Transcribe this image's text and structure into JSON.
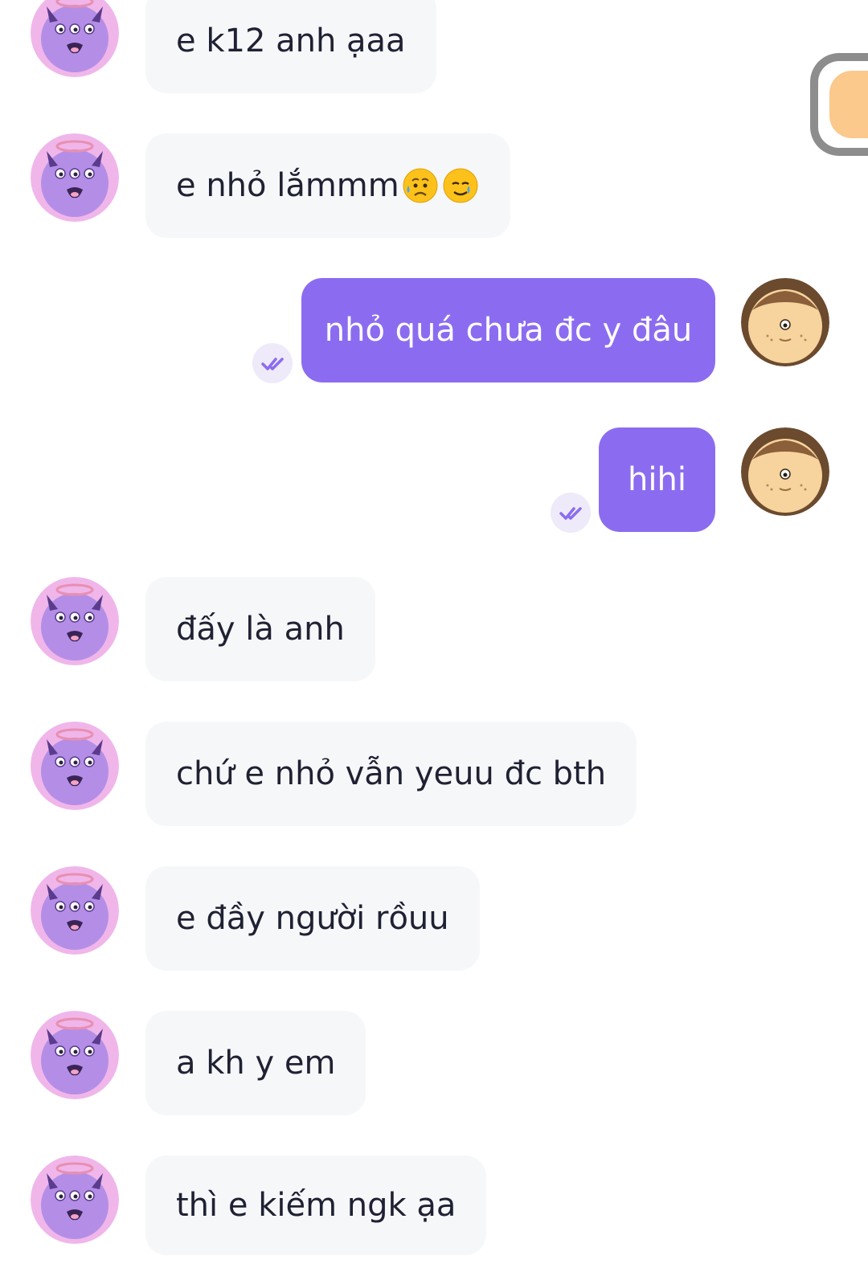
{
  "conversation": {
    "messages": [
      {
        "direction": "incoming",
        "text": "e k12 anh ạaa"
      },
      {
        "direction": "incoming",
        "text": "e nhỏ lắmmm",
        "emojis": [
          "sad-relieved-face-emoji",
          "smiling-face-with-tear-emoji"
        ]
      },
      {
        "direction": "outgoing",
        "text": "nhỏ quá chưa đc y đâu",
        "status": "read"
      },
      {
        "direction": "outgoing",
        "text": "hihi",
        "status": "read"
      },
      {
        "direction": "incoming",
        "text": "đấy là anh"
      },
      {
        "direction": "incoming",
        "text": "chứ e nhỏ vẫn yeuu đc bth"
      },
      {
        "direction": "incoming",
        "text": "e đầy người rồuu"
      },
      {
        "direction": "incoming",
        "text": "a kh y em"
      },
      {
        "direction": "incoming",
        "text": "thì e kiếm ngk ạa"
      }
    ]
  },
  "avatars": {
    "contact": "purple-monster-avatar",
    "self": "furry-beige-monster-avatar"
  },
  "icons": {
    "read_receipt": "double-check-icon",
    "floating_button": "floating-bubble-icon"
  },
  "colors": {
    "outgoing_bubble": "#8b6cf0",
    "incoming_bubble": "#f6f7f9",
    "incoming_text": "#1f2133",
    "outgoing_text": "#ffffff",
    "read_receipt": "#8b6cf0"
  }
}
